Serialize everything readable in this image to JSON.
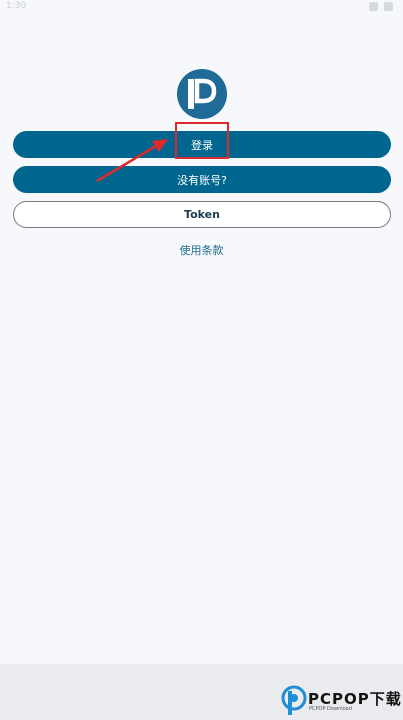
{
  "status_bar": {
    "time": "1:30"
  },
  "buttons": {
    "login": "登录",
    "register": "没有账号?",
    "token": "Token"
  },
  "terms": {
    "label": "使用条款"
  },
  "watermark": {
    "brand": "PCPOP下载",
    "sub": "PCPOP Download"
  },
  "colors": {
    "primary": "#006690",
    "logo": "#1f6a97",
    "annotation": "#e0292b",
    "background": "#f6f8fc"
  },
  "icons": {
    "logo": "pixiv-p-logo",
    "arrow": "annotation-arrow"
  }
}
